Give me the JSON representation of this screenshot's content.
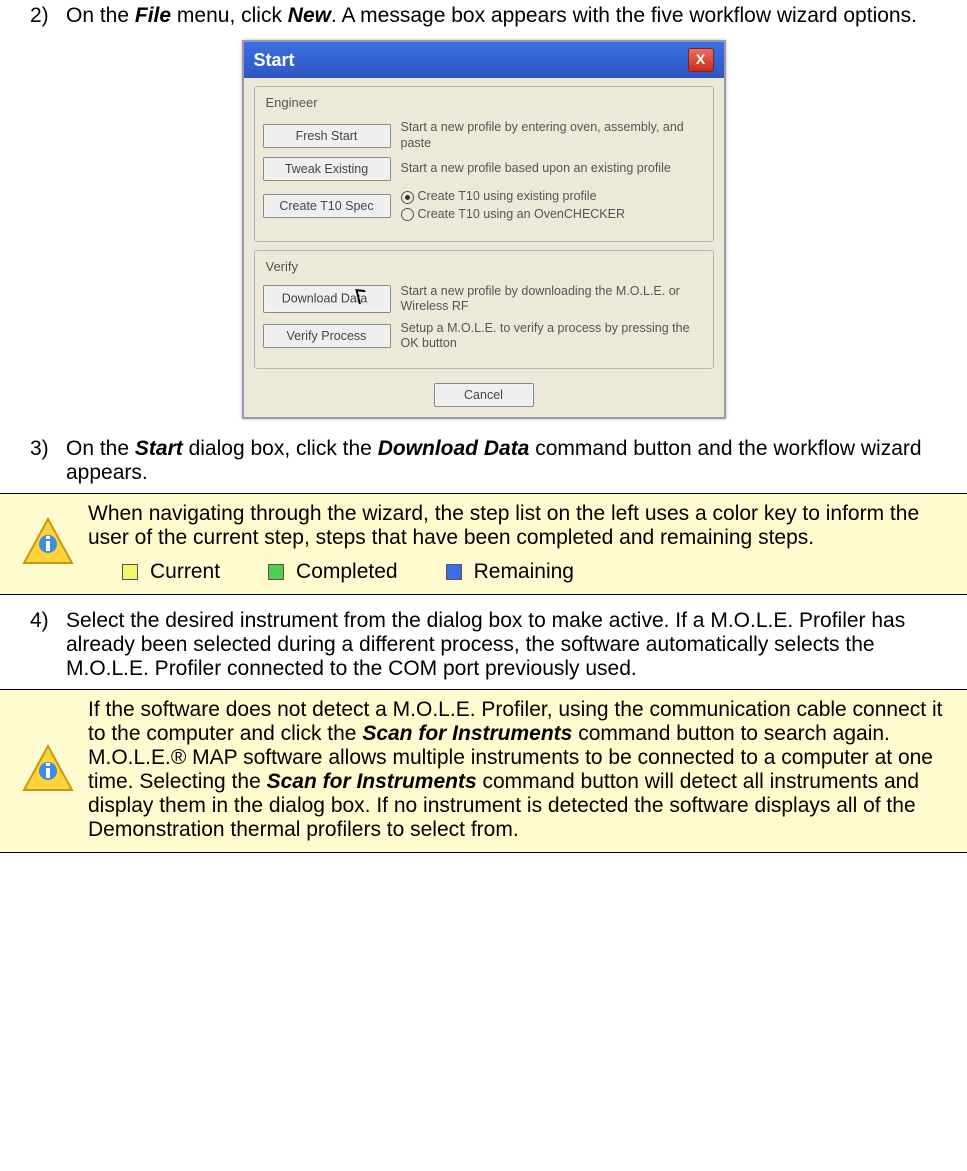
{
  "steps": {
    "s2": {
      "num": "2)",
      "pre": "On the ",
      "b1": "File",
      "mid": " menu, click ",
      "b2": "New",
      "post": ". A message box appears with the five workflow wizard options."
    },
    "s3": {
      "num": "3)",
      "pre": "On the ",
      "b1": "Start",
      "mid": " dialog box, click the ",
      "b2": "Download Data",
      "post": " command button and the workflow wizard appears."
    },
    "s4": {
      "num": "4)",
      "txt": "Select the desired instrument from the dialog box to make active. If a M.O.L.E. Profiler has already been selected during a different process, the software automatically selects the M.O.L.E. Profiler connected to the COM port previously used."
    }
  },
  "dialog": {
    "title": "Start",
    "close": "X",
    "group_engineer": "Engineer",
    "group_verify": "Verify",
    "btn_fresh": "Fresh Start",
    "desc_fresh": "Start a new profile by entering oven, assembly, and paste",
    "btn_tweak": "Tweak Existing",
    "desc_tweak": "Start a new profile based upon an existing profile",
    "btn_t10": "Create T10 Spec",
    "radio1": "Create T10 using existing profile",
    "radio2": "Create T10 using an OvenCHECKER",
    "btn_download": "Download Data",
    "desc_download": "Start a new profile by downloading the M.O.L.E. or Wireless RF",
    "btn_verify": "Verify Process",
    "desc_verify": "Setup a M.O.L.E. to verify a process by pressing the OK button",
    "cancel": "Cancel"
  },
  "note1": {
    "text": "When navigating through the wizard, the step list on the left uses a color key to inform the user of the current step, steps that have been completed and remaining steps.",
    "legend": {
      "current": "Current",
      "completed": "Completed",
      "remaining": "Remaining"
    }
  },
  "note2": {
    "pre": "If the software does not detect a M.O.L.E. Profiler, using the communication cable connect it to the computer and click the ",
    "b1": "Scan for Instruments",
    "mid": " command button to search again. M.O.L.E.® MAP software allows multiple instruments to be connected to a computer at one time. Selecting the ",
    "b2": "Scan for Instruments",
    "post": " command button will detect all instruments and display them in the dialog box. If no instrument is detected the software displays all of the Demonstration thermal profilers to select from."
  }
}
